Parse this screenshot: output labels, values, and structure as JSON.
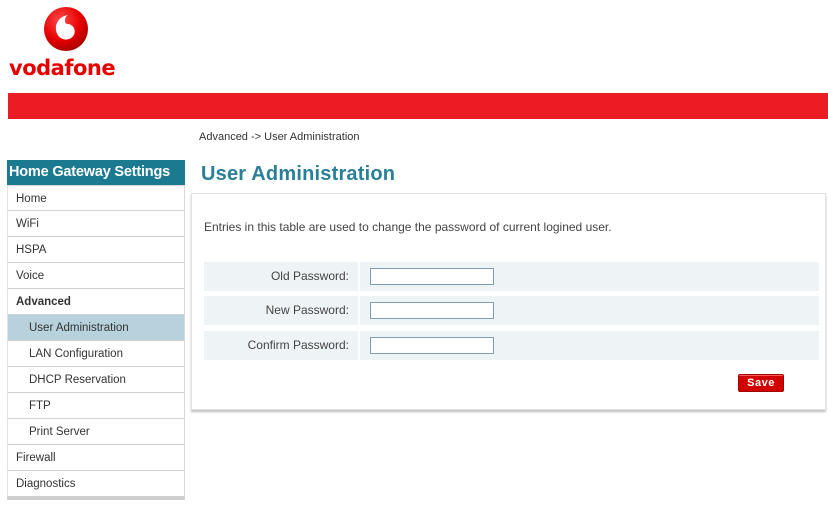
{
  "brand": {
    "name": "vodafone",
    "color": "#e60000",
    "band_color": "#ec1c24",
    "logo_icon": "vodafone-speechmark-icon"
  },
  "breadcrumb": "Advanced -> User Administration",
  "sidebar": {
    "header": "Home Gateway Settings",
    "header_color": "#1b7a90",
    "items": [
      {
        "label": "Home"
      },
      {
        "label": "WiFi"
      },
      {
        "label": "HSPA"
      },
      {
        "label": "Voice"
      },
      {
        "label": "Advanced",
        "expanded": true
      },
      {
        "label": "User Administration",
        "active": true,
        "sub": true
      },
      {
        "label": "LAN Configuration",
        "sub": true
      },
      {
        "label": "DHCP Reservation",
        "sub": true
      },
      {
        "label": "FTP",
        "sub": true
      },
      {
        "label": "Print Server",
        "sub": true
      },
      {
        "label": "Firewall"
      },
      {
        "label": "Diagnostics"
      }
    ]
  },
  "main": {
    "title": "User Administration",
    "intro": "Entries in this table are used to change the password of current logined user.",
    "fields": [
      {
        "label": "Old Password:",
        "value": ""
      },
      {
        "label": "New Password:",
        "value": ""
      },
      {
        "label": "Confirm Password:",
        "value": ""
      }
    ],
    "save_label": "Save",
    "save_color": "#d10000"
  }
}
